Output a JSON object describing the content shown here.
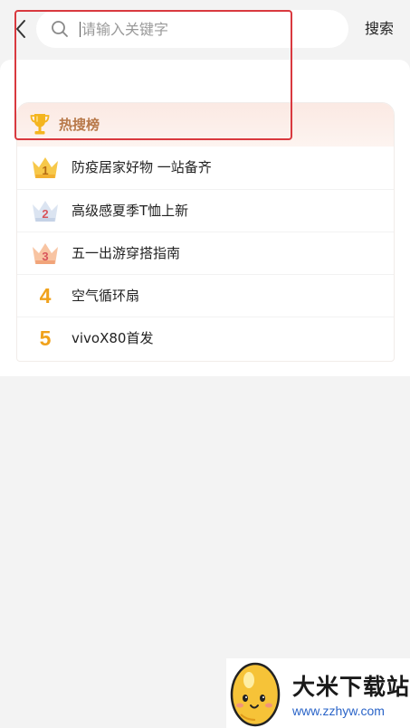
{
  "search": {
    "placeholder": "请输入关键字",
    "value": "",
    "submit_label": "搜索"
  },
  "icons": {
    "back": "chevron-left-icon",
    "search": "search-icon",
    "trophy": "trophy-icon",
    "crown": "crown-icon"
  },
  "hot_list": {
    "title": "热搜榜",
    "items": [
      {
        "rank": "1",
        "text": "防疫居家好物 一站备齐"
      },
      {
        "rank": "2",
        "text": "高级感夏季T恤上新"
      },
      {
        "rank": "3",
        "text": "五一出游穿搭指南"
      },
      {
        "rank": "4",
        "text": "空气循环扇"
      },
      {
        "rank": "5",
        "text": "vivoX80首发"
      }
    ]
  },
  "watermark": {
    "title": "大米下载站",
    "url": "www.zzhyw.com"
  },
  "colors": {
    "accent_gold": "#f0a21c",
    "hot_title": "#b8794a",
    "highlight_red": "#d9393f",
    "crown_gold": "#f5b733",
    "crown_silver": "#c9d6ea",
    "crown_bronze": "#f4b08a"
  }
}
